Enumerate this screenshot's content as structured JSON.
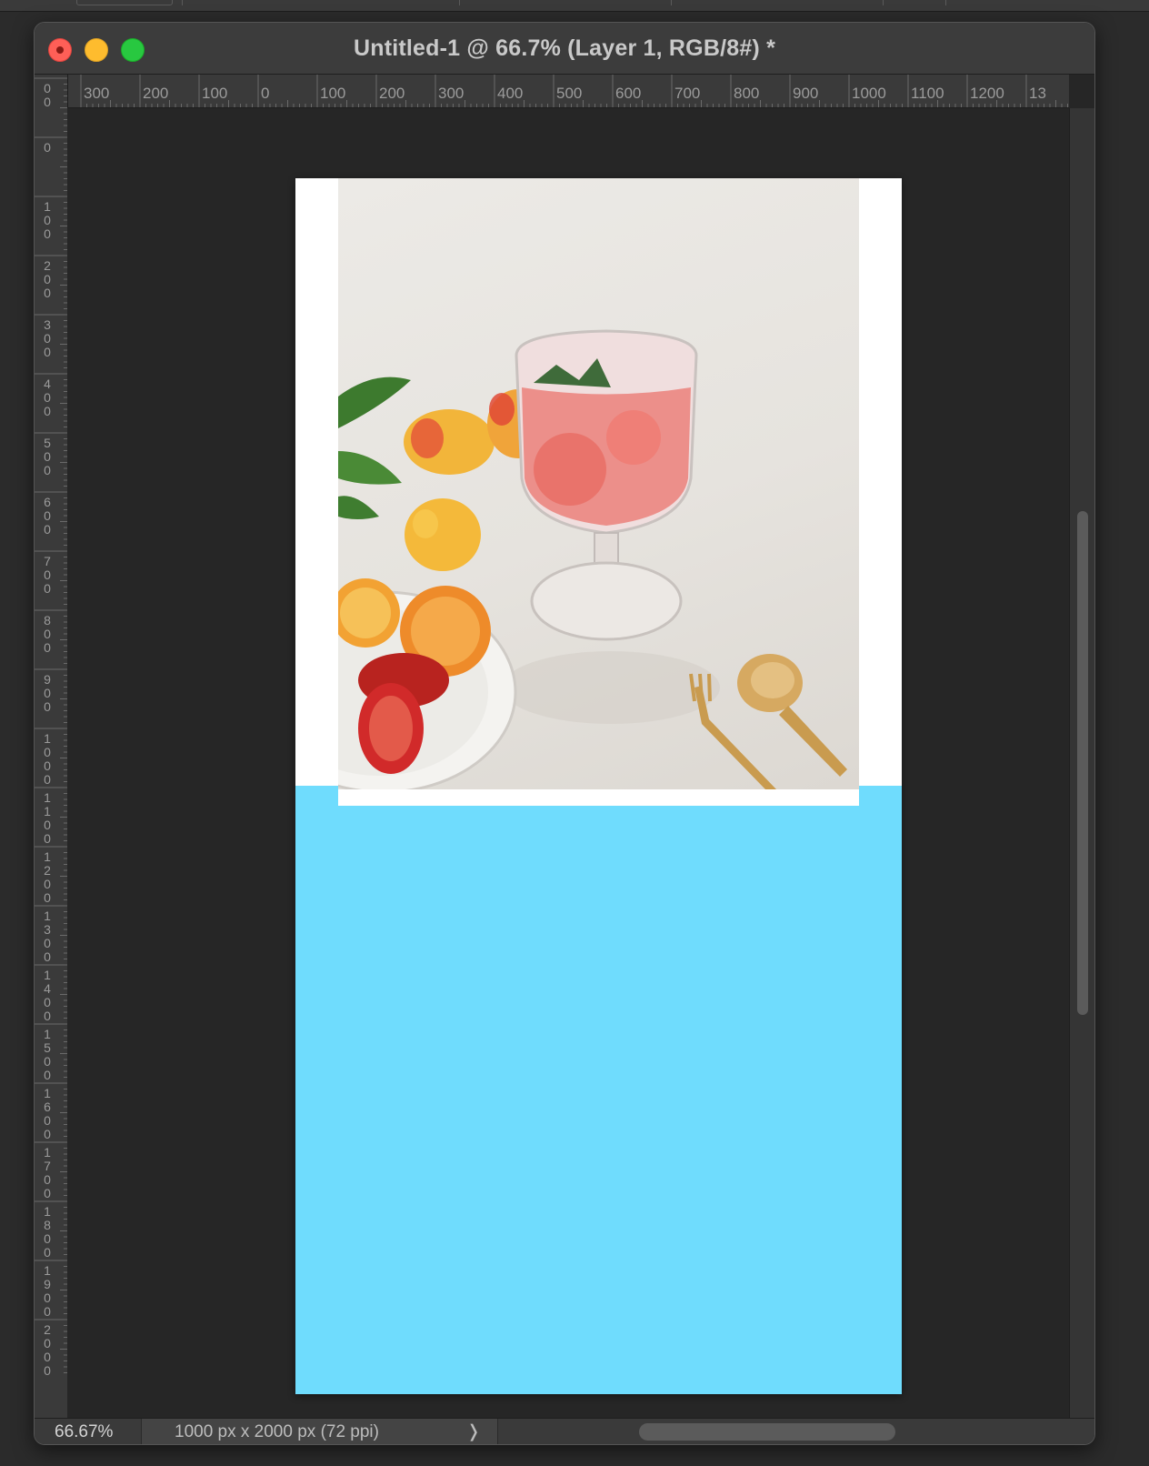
{
  "window": {
    "title": "Untitled-1 @ 66.7% (Layer 1, RGB/8#) *"
  },
  "rulers": {
    "horizontal": [
      "300",
      "200",
      "100",
      "0",
      "100",
      "200",
      "300",
      "400",
      "500",
      "600",
      "700",
      "800",
      "900",
      "1000",
      "1100",
      "1200",
      "13"
    ],
    "vertical": [
      "00",
      "0",
      "100",
      "200",
      "300",
      "400",
      "500",
      "600",
      "700",
      "800",
      "900",
      "1000",
      "1100",
      "1200",
      "1300",
      "1400",
      "1500",
      "1600",
      "1700",
      "1800",
      "1900",
      "2000"
    ]
  },
  "document": {
    "background_color": "#6fdcfd",
    "white_color": "#ffffff"
  },
  "statusbar": {
    "zoom": "66.67%",
    "doc_info": "1000 px x 2000 px (72 ppi)",
    "arrow_icon": "chevron-right-icon"
  },
  "colors": {
    "close": "#fe5f57",
    "minimize": "#febc2e",
    "maximize": "#28c840",
    "canvas_bg": "#262626"
  }
}
